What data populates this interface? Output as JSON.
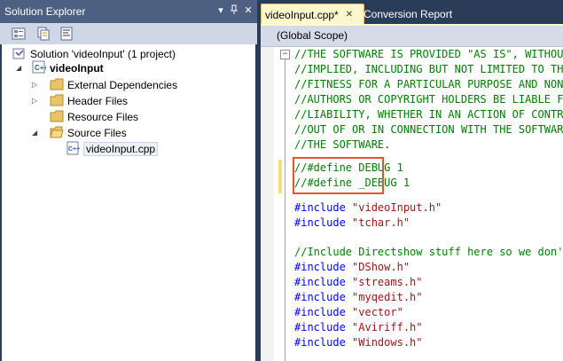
{
  "solution_explorer": {
    "title": "Solution Explorer",
    "controls": {
      "dropdown": "▾",
      "pin": "📌",
      "close": "✕"
    },
    "toolbar": {
      "buttons": [
        "properties-icon",
        "show-all-files-icon",
        "view-code-icon"
      ]
    },
    "tree": {
      "solution": "Solution 'videoInput' (1 project)",
      "project": "videoInput",
      "folders": [
        {
          "label": "External Dependencies"
        },
        {
          "label": "Header Files"
        },
        {
          "label": "Resource Files"
        },
        {
          "label": "Source Files"
        }
      ],
      "file": "videoInput.cpp"
    }
  },
  "editor": {
    "tabs": [
      {
        "label": "videoInput.cpp*",
        "close": "✕"
      },
      {
        "label": "Conversion Report"
      }
    ],
    "scope": "(Global Scope)",
    "collapse_glyph": "−",
    "colors": {
      "comment": "#008000",
      "keyword": "#0000ff",
      "string": "#a31515",
      "highlight_box": "#e8532f",
      "change_bar": "#f5de6e"
    },
    "code": {
      "license": [
        "//THE SOFTWARE IS PROVIDED \"AS IS\", WITHOUT WARRANTY",
        "//IMPLIED, INCLUDING BUT NOT LIMITED TO THE WARRANTIES",
        "//FITNESS FOR A PARTICULAR PURPOSE AND NONINFRINGEMENT",
        "//AUTHORS OR COPYRIGHT HOLDERS BE LIABLE FOR ANY CLAIM",
        "//LIABILITY, WHETHER IN AN ACTION OF CONTRACT, TORT OR",
        "//OUT OF OR IN CONNECTION WITH THE SOFTWARE OR THE USE",
        "//THE SOFTWARE."
      ],
      "defines": [
        "//#define DEBUG 1",
        "//#define _DEBUG 1"
      ],
      "include_keyword": "#include",
      "includes_a": [
        "\"videoInput.h\"",
        "\"tchar.h\""
      ],
      "directshow_comment": "//Include Directshow stuff here so we don't worry",
      "includes_b": [
        "\"DShow.h\"",
        "\"streams.h\"",
        "\"myqedit.h\"",
        "\"vector\"",
        "\"Aviriff.h\"",
        "\"Windows.h\""
      ]
    }
  }
}
